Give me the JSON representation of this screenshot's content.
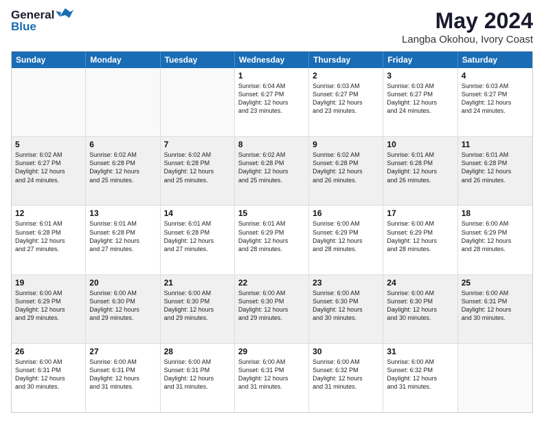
{
  "logo": {
    "line1": "General",
    "line2": "Blue"
  },
  "title": "May 2024",
  "subtitle": "Langba Okohou, Ivory Coast",
  "days": [
    "Sunday",
    "Monday",
    "Tuesday",
    "Wednesday",
    "Thursday",
    "Friday",
    "Saturday"
  ],
  "rows": [
    [
      {
        "day": "",
        "lines": []
      },
      {
        "day": "",
        "lines": []
      },
      {
        "day": "",
        "lines": []
      },
      {
        "day": "1",
        "lines": [
          "Sunrise: 6:04 AM",
          "Sunset: 6:27 PM",
          "Daylight: 12 hours",
          "and 23 minutes."
        ]
      },
      {
        "day": "2",
        "lines": [
          "Sunrise: 6:03 AM",
          "Sunset: 6:27 PM",
          "Daylight: 12 hours",
          "and 23 minutes."
        ]
      },
      {
        "day": "3",
        "lines": [
          "Sunrise: 6:03 AM",
          "Sunset: 6:27 PM",
          "Daylight: 12 hours",
          "and 24 minutes."
        ]
      },
      {
        "day": "4",
        "lines": [
          "Sunrise: 6:03 AM",
          "Sunset: 6:27 PM",
          "Daylight: 12 hours",
          "and 24 minutes."
        ]
      }
    ],
    [
      {
        "day": "5",
        "lines": [
          "Sunrise: 6:02 AM",
          "Sunset: 6:27 PM",
          "Daylight: 12 hours",
          "and 24 minutes."
        ]
      },
      {
        "day": "6",
        "lines": [
          "Sunrise: 6:02 AM",
          "Sunset: 6:28 PM",
          "Daylight: 12 hours",
          "and 25 minutes."
        ]
      },
      {
        "day": "7",
        "lines": [
          "Sunrise: 6:02 AM",
          "Sunset: 6:28 PM",
          "Daylight: 12 hours",
          "and 25 minutes."
        ]
      },
      {
        "day": "8",
        "lines": [
          "Sunrise: 6:02 AM",
          "Sunset: 6:28 PM",
          "Daylight: 12 hours",
          "and 25 minutes."
        ]
      },
      {
        "day": "9",
        "lines": [
          "Sunrise: 6:02 AM",
          "Sunset: 6:28 PM",
          "Daylight: 12 hours",
          "and 26 minutes."
        ]
      },
      {
        "day": "10",
        "lines": [
          "Sunrise: 6:01 AM",
          "Sunset: 6:28 PM",
          "Daylight: 12 hours",
          "and 26 minutes."
        ]
      },
      {
        "day": "11",
        "lines": [
          "Sunrise: 6:01 AM",
          "Sunset: 6:28 PM",
          "Daylight: 12 hours",
          "and 26 minutes."
        ]
      }
    ],
    [
      {
        "day": "12",
        "lines": [
          "Sunrise: 6:01 AM",
          "Sunset: 6:28 PM",
          "Daylight: 12 hours",
          "and 27 minutes."
        ]
      },
      {
        "day": "13",
        "lines": [
          "Sunrise: 6:01 AM",
          "Sunset: 6:28 PM",
          "Daylight: 12 hours",
          "and 27 minutes."
        ]
      },
      {
        "day": "14",
        "lines": [
          "Sunrise: 6:01 AM",
          "Sunset: 6:28 PM",
          "Daylight: 12 hours",
          "and 27 minutes."
        ]
      },
      {
        "day": "15",
        "lines": [
          "Sunrise: 6:01 AM",
          "Sunset: 6:29 PM",
          "Daylight: 12 hours",
          "and 28 minutes."
        ]
      },
      {
        "day": "16",
        "lines": [
          "Sunrise: 6:00 AM",
          "Sunset: 6:29 PM",
          "Daylight: 12 hours",
          "and 28 minutes."
        ]
      },
      {
        "day": "17",
        "lines": [
          "Sunrise: 6:00 AM",
          "Sunset: 6:29 PM",
          "Daylight: 12 hours",
          "and 28 minutes."
        ]
      },
      {
        "day": "18",
        "lines": [
          "Sunrise: 6:00 AM",
          "Sunset: 6:29 PM",
          "Daylight: 12 hours",
          "and 28 minutes."
        ]
      }
    ],
    [
      {
        "day": "19",
        "lines": [
          "Sunrise: 6:00 AM",
          "Sunset: 6:29 PM",
          "Daylight: 12 hours",
          "and 29 minutes."
        ]
      },
      {
        "day": "20",
        "lines": [
          "Sunrise: 6:00 AM",
          "Sunset: 6:30 PM",
          "Daylight: 12 hours",
          "and 29 minutes."
        ]
      },
      {
        "day": "21",
        "lines": [
          "Sunrise: 6:00 AM",
          "Sunset: 6:30 PM",
          "Daylight: 12 hours",
          "and 29 minutes."
        ]
      },
      {
        "day": "22",
        "lines": [
          "Sunrise: 6:00 AM",
          "Sunset: 6:30 PM",
          "Daylight: 12 hours",
          "and 29 minutes."
        ]
      },
      {
        "day": "23",
        "lines": [
          "Sunrise: 6:00 AM",
          "Sunset: 6:30 PM",
          "Daylight: 12 hours",
          "and 30 minutes."
        ]
      },
      {
        "day": "24",
        "lines": [
          "Sunrise: 6:00 AM",
          "Sunset: 6:30 PM",
          "Daylight: 12 hours",
          "and 30 minutes."
        ]
      },
      {
        "day": "25",
        "lines": [
          "Sunrise: 6:00 AM",
          "Sunset: 6:31 PM",
          "Daylight: 12 hours",
          "and 30 minutes."
        ]
      }
    ],
    [
      {
        "day": "26",
        "lines": [
          "Sunrise: 6:00 AM",
          "Sunset: 6:31 PM",
          "Daylight: 12 hours",
          "and 30 minutes."
        ]
      },
      {
        "day": "27",
        "lines": [
          "Sunrise: 6:00 AM",
          "Sunset: 6:31 PM",
          "Daylight: 12 hours",
          "and 31 minutes."
        ]
      },
      {
        "day": "28",
        "lines": [
          "Sunrise: 6:00 AM",
          "Sunset: 6:31 PM",
          "Daylight: 12 hours",
          "and 31 minutes."
        ]
      },
      {
        "day": "29",
        "lines": [
          "Sunrise: 6:00 AM",
          "Sunset: 6:31 PM",
          "Daylight: 12 hours",
          "and 31 minutes."
        ]
      },
      {
        "day": "30",
        "lines": [
          "Sunrise: 6:00 AM",
          "Sunset: 6:32 PM",
          "Daylight: 12 hours",
          "and 31 minutes."
        ]
      },
      {
        "day": "31",
        "lines": [
          "Sunrise: 6:00 AM",
          "Sunset: 6:32 PM",
          "Daylight: 12 hours",
          "and 31 minutes."
        ]
      },
      {
        "day": "",
        "lines": []
      }
    ]
  ]
}
